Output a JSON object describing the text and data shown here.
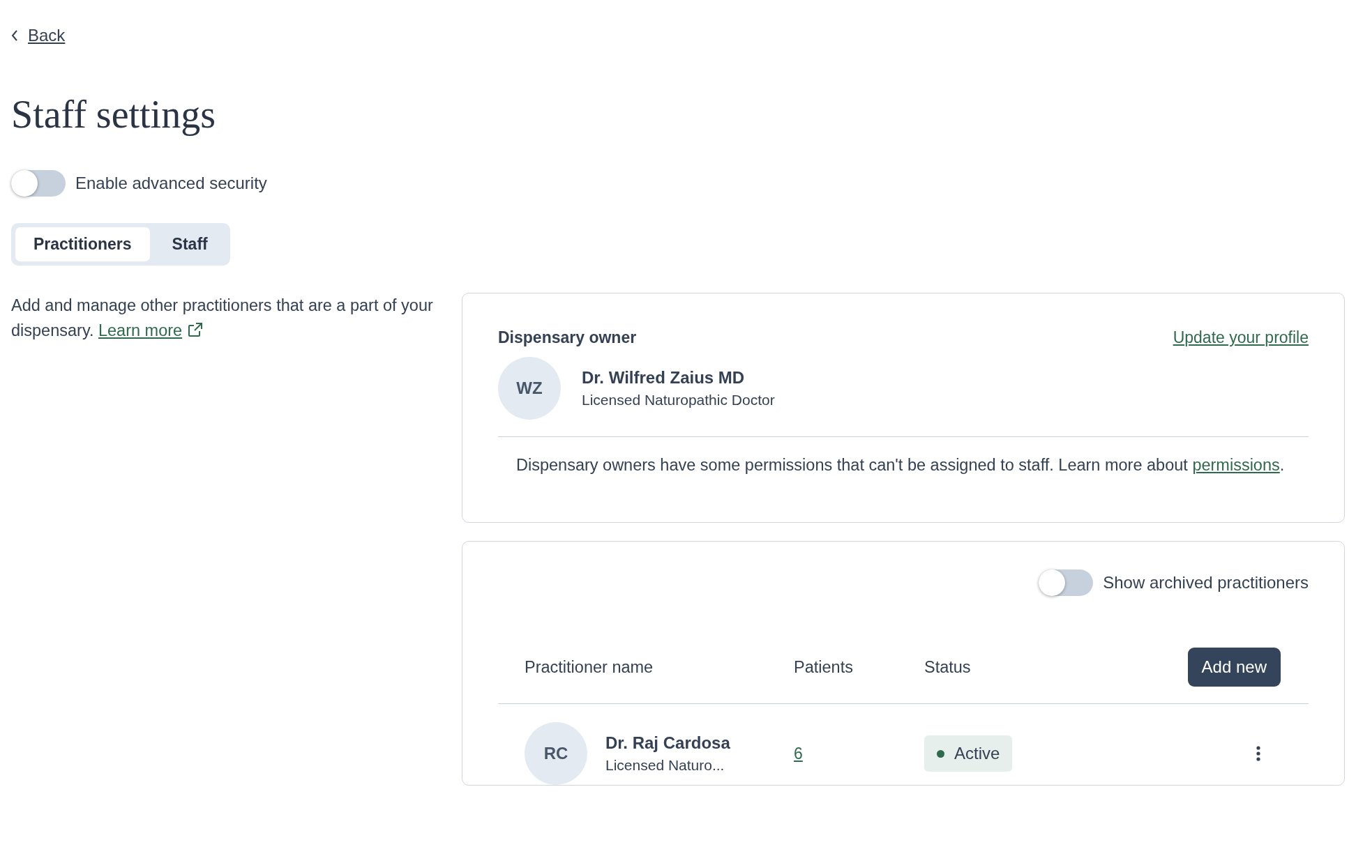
{
  "back_link": {
    "label": "Back"
  },
  "title": "Staff settings",
  "advanced_security": {
    "label": "Enable advanced security",
    "on": false
  },
  "tabs": [
    {
      "label": "Practitioners",
      "selected": true
    },
    {
      "label": "Staff",
      "selected": false
    }
  ],
  "description": {
    "text": "Add and manage other practitioners that are a part of your dispensary.",
    "link": "Learn more"
  },
  "owner_card": {
    "heading": "Dispensary owner",
    "link": "Update your profile",
    "initials": "WZ",
    "name": "Dr. Wilfred Zaius MD",
    "role": "Licensed Naturopathic Doctor",
    "note": "Dispensary owners have some permissions that can't be assigned to staff. Learn more about",
    "note_link": "permissions",
    "note_end": "."
  },
  "practitioners_card": {
    "archived_toggle": {
      "label": "Show archived practitioners",
      "on": false
    },
    "columns": [
      "Practitioner name",
      "Patients",
      "Status"
    ],
    "add_button": "Add new",
    "rows": [
      {
        "initials": "RC",
        "name": "Dr. Raj Cardosa",
        "role": "Licensed Naturo...",
        "patients": "6",
        "status": "Active",
        "color": "#2e6b4c"
      }
    ]
  }
}
